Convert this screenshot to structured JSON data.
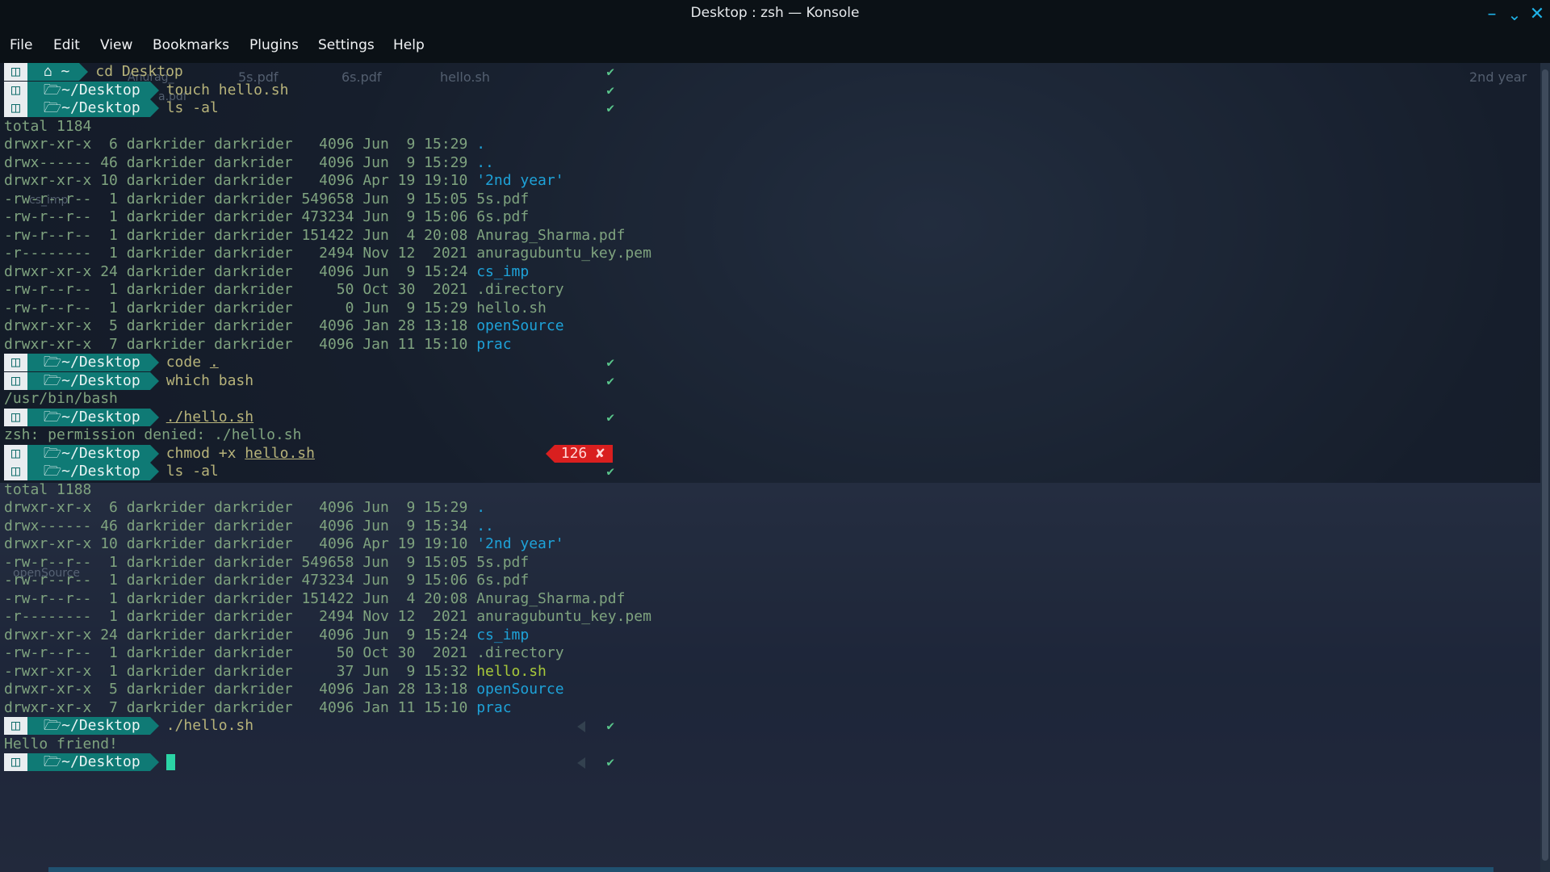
{
  "window": {
    "title": "Desktop : zsh — Konsole",
    "accent": "#1fb3e8",
    "controls": [
      "minimize-icon",
      "maximize-icon",
      "close-icon"
    ]
  },
  "menu": [
    "File",
    "Edit",
    "View",
    "Bookmarks",
    "Plugins",
    "Settings",
    "Help"
  ],
  "desktop_ghosts": [
    "5s.pdf",
    "6s.pdf",
    "hello.sh",
    "2nd year",
    "Anurag_",
    "a.pdf",
    "cs_imp",
    "openSource"
  ],
  "prompt": {
    "home": "~",
    "desktop": "~/Desktop",
    "ok": "✔",
    "err_code": "126",
    "err_mark": "✘"
  },
  "terminal": {
    "cmd1": "cd Desktop",
    "cmd2": "touch hello.sh",
    "cmd3": "ls -al",
    "listing1": {
      "total": "total 1184",
      "rows": [
        {
          "meta": "drwxr-xr-x  6 darkrider darkrider   4096 Jun  9 15:29 ",
          "name": "."
        },
        {
          "meta": "drwx------ 46 darkrider darkrider   4096 Jun  9 15:29 ",
          "name": ".."
        },
        {
          "meta": "drwxr-xr-x 10 darkrider darkrider   4096 Apr 19 19:10 ",
          "name": "'2nd year'"
        },
        {
          "meta": "-rw-r--r--  1 darkrider darkrider 549658 Jun  9 15:05 ",
          "name": "5s.pdf"
        },
        {
          "meta": "-rw-r--r--  1 darkrider darkrider 473234 Jun  9 15:06 ",
          "name": "6s.pdf"
        },
        {
          "meta": "-rw-r--r--  1 darkrider darkrider 151422 Jun  4 20:08 ",
          "name": "Anurag_Sharma.pdf"
        },
        {
          "meta": "-r--------  1 darkrider darkrider   2494 Nov 12  2021 ",
          "name": "anuragubuntu_key.pem"
        },
        {
          "meta": "drwxr-xr-x 24 darkrider darkrider   4096 Jun  9 15:24 ",
          "name": "cs_imp"
        },
        {
          "meta": "-rw-r--r--  1 darkrider darkrider     50 Oct 30  2021 ",
          "name": ".directory"
        },
        {
          "meta": "-rw-r--r--  1 darkrider darkrider      0 Jun  9 15:29 ",
          "name": "hello.sh"
        },
        {
          "meta": "drwxr-xr-x  5 darkrider darkrider   4096 Jan 28 13:18 ",
          "name": "openSource"
        },
        {
          "meta": "drwxr-xr-x  7 darkrider darkrider   4096 Jan 11 15:10 ",
          "name": "prac"
        }
      ]
    },
    "cmd4a": "code ",
    "cmd4b": ".",
    "cmd5": "which bash",
    "out5": "/usr/bin/bash",
    "cmd6": "./hello.sh",
    "out6": "zsh: permission denied: ./hello.sh",
    "cmd7a": "chmod +x ",
    "cmd7b": "hello.sh",
    "cmd8": "ls -al",
    "listing2": {
      "total": "total 1188",
      "rows": [
        {
          "meta": "drwxr-xr-x  6 darkrider darkrider   4096 Jun  9 15:29 ",
          "name": "."
        },
        {
          "meta": "drwx------ 46 darkrider darkrider   4096 Jun  9 15:34 ",
          "name": ".."
        },
        {
          "meta": "drwxr-xr-x 10 darkrider darkrider   4096 Apr 19 19:10 ",
          "name": "'2nd year'"
        },
        {
          "meta": "-rw-r--r--  1 darkrider darkrider 549658 Jun  9 15:05 ",
          "name": "5s.pdf"
        },
        {
          "meta": "-rw-r--r--  1 darkrider darkrider 473234 Jun  9 15:06 ",
          "name": "6s.pdf"
        },
        {
          "meta": "-rw-r--r--  1 darkrider darkrider 151422 Jun  4 20:08 ",
          "name": "Anurag_Sharma.pdf"
        },
        {
          "meta": "-r--------  1 darkrider darkrider   2494 Nov 12  2021 ",
          "name": "anuragubuntu_key.pem"
        },
        {
          "meta": "drwxr-xr-x 24 darkrider darkrider   4096 Jun  9 15:24 ",
          "name": "cs_imp"
        },
        {
          "meta": "-rw-r--r--  1 darkrider darkrider     50 Oct 30  2021 ",
          "name": ".directory"
        },
        {
          "meta": "-rwxr-xr-x  1 darkrider darkrider     37 Jun  9 15:32 ",
          "name": "hello.sh"
        },
        {
          "meta": "drwxr-xr-x  5 darkrider darkrider   4096 Jan 28 13:18 ",
          "name": "openSource"
        },
        {
          "meta": "drwxr-xr-x  7 darkrider darkrider   4096 Jan 11 15:10 ",
          "name": "prac"
        }
      ]
    },
    "cmd9": "./hello.sh",
    "out9": "Hello friend!"
  }
}
